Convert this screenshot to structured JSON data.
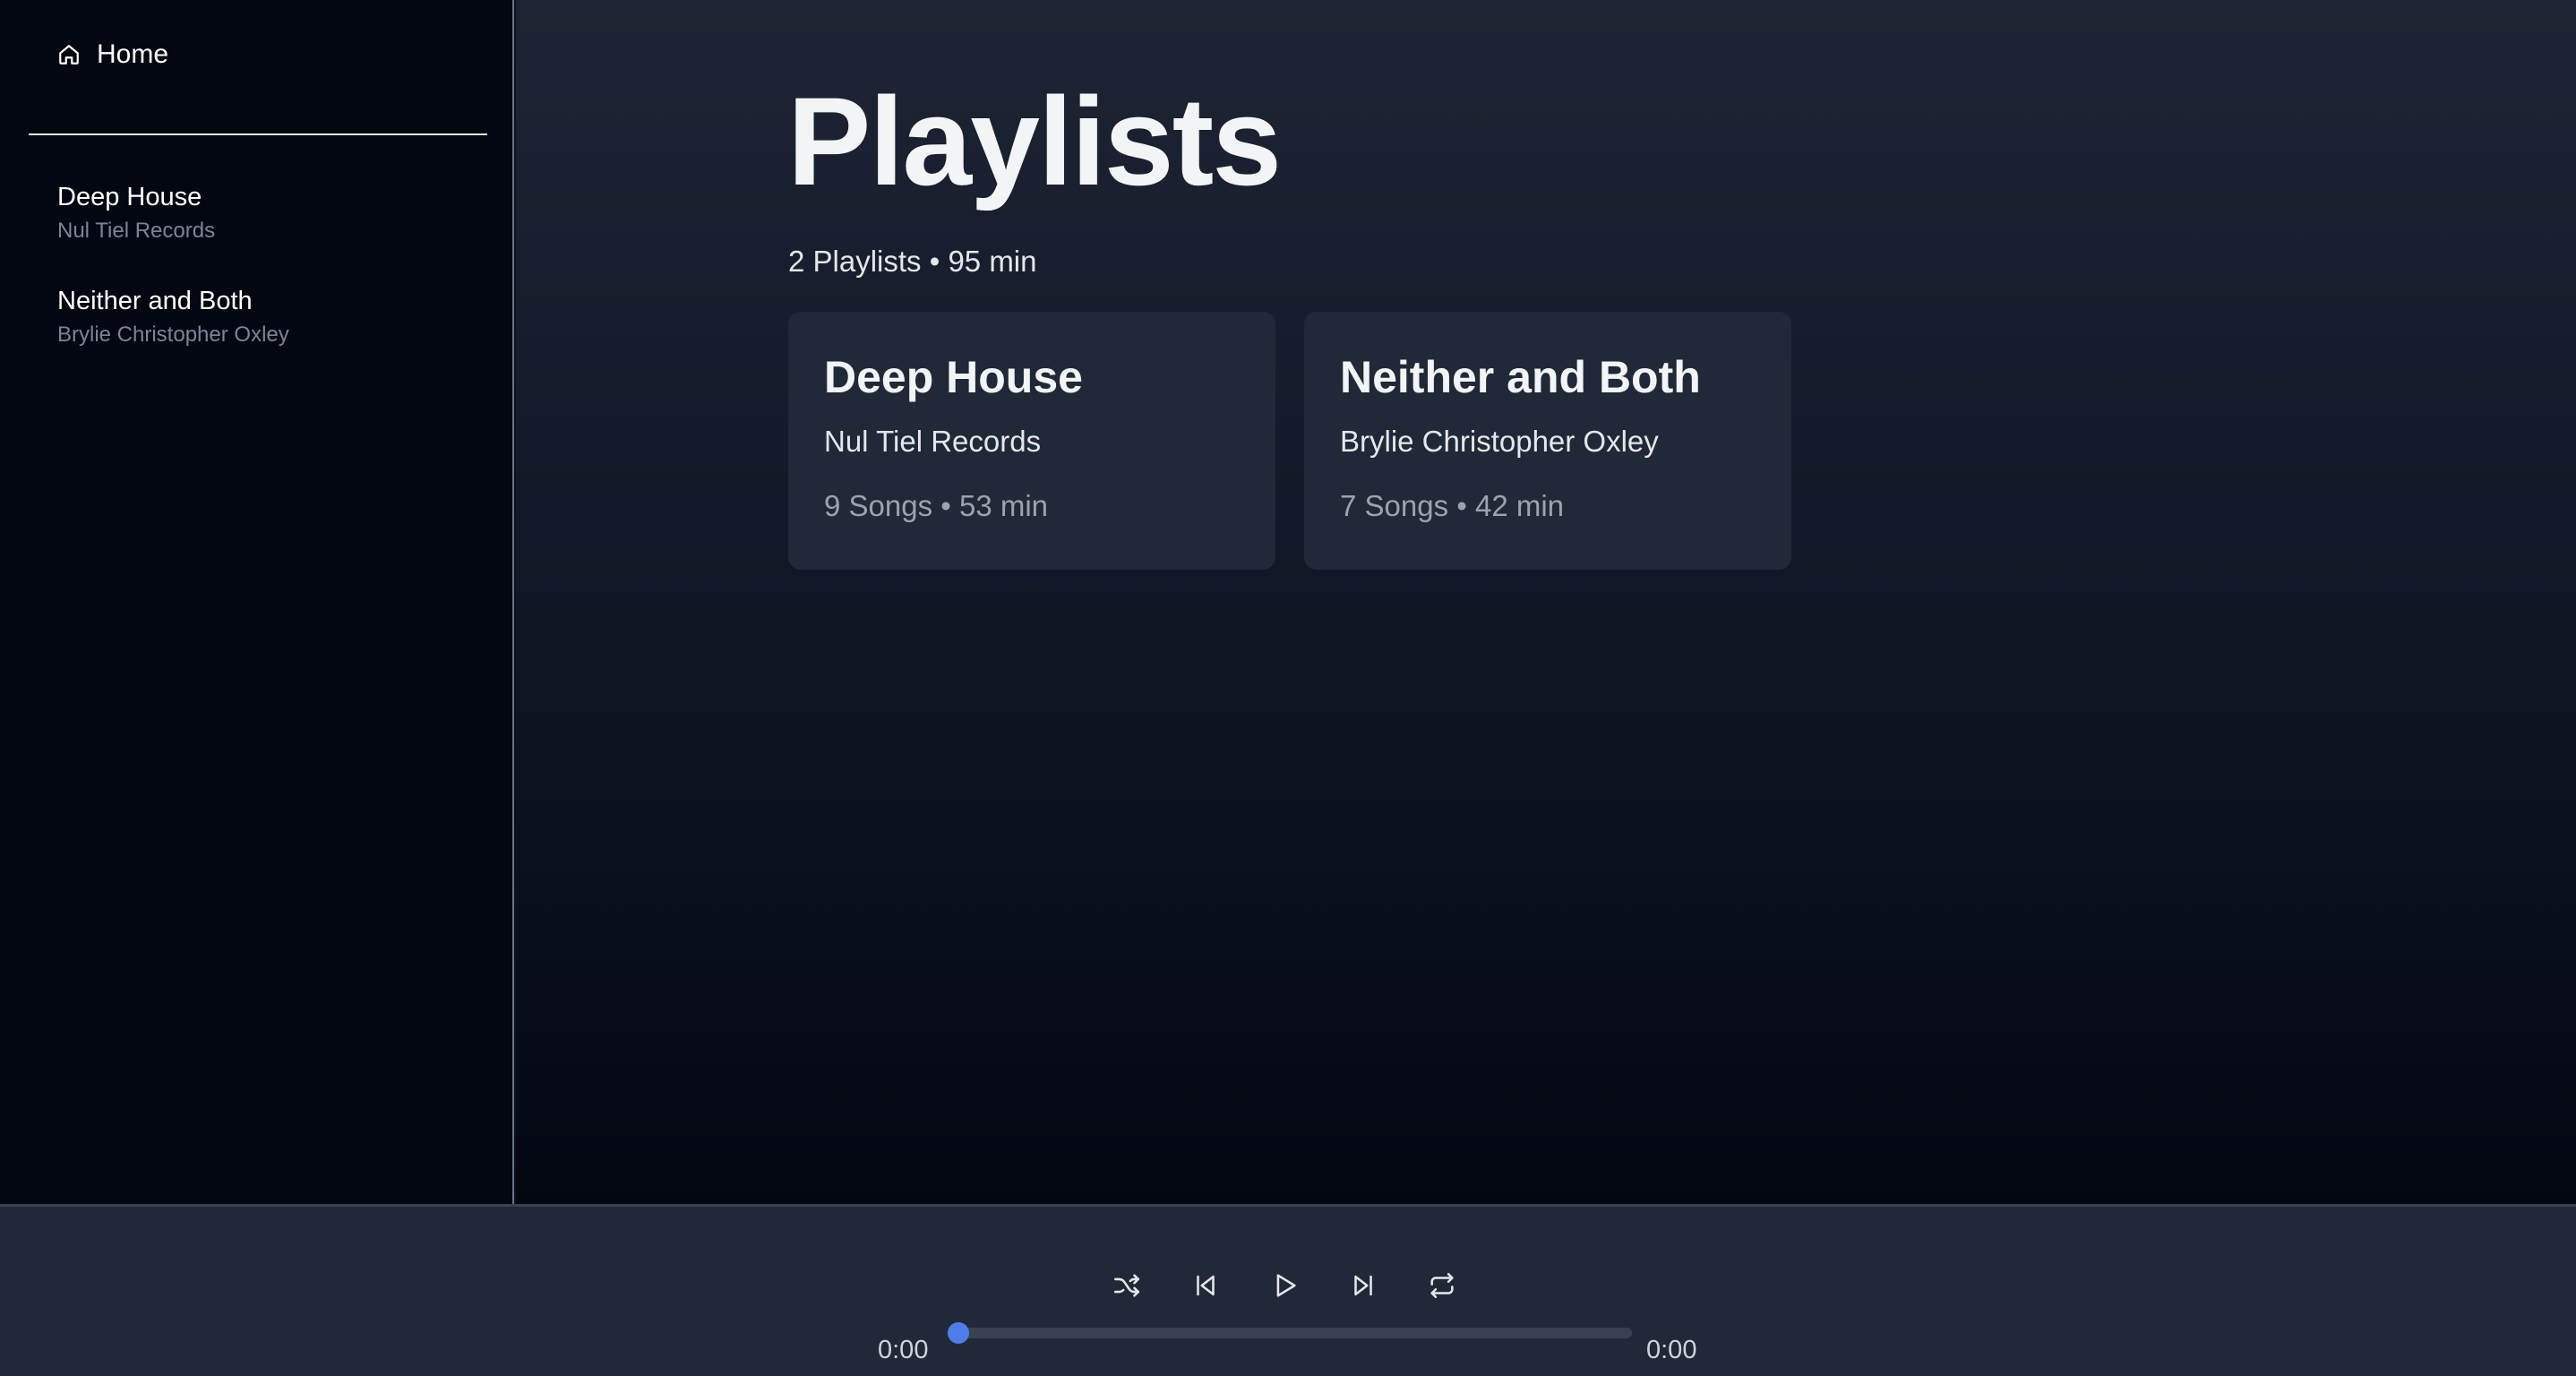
{
  "sidebar": {
    "home_label": "Home",
    "items": [
      {
        "title": "Deep House",
        "subtitle": "Nul Tiel Records"
      },
      {
        "title": "Neither and Both",
        "subtitle": "Brylie Christopher Oxley"
      }
    ]
  },
  "main": {
    "title": "Playlists",
    "stats": "2 Playlists • 95 min",
    "cards": [
      {
        "title": "Deep House",
        "owner": "Nul Tiel Records",
        "meta": "9 Songs • 53 min"
      },
      {
        "title": "Neither and Both",
        "owner": "Brylie Christopher Oxley",
        "meta": "7 Songs • 42 min"
      }
    ]
  },
  "player": {
    "current_time": "0:00",
    "total_time": "0:00",
    "progress": 0,
    "controls": [
      "shuffle-icon",
      "previous-icon",
      "play-icon",
      "next-icon",
      "repeat-icon"
    ]
  },
  "colors": {
    "accent": "#4f7de8",
    "sidebar_bg": "#030712",
    "card_bg": "#1f2937",
    "player_bg": "#1f2937"
  }
}
